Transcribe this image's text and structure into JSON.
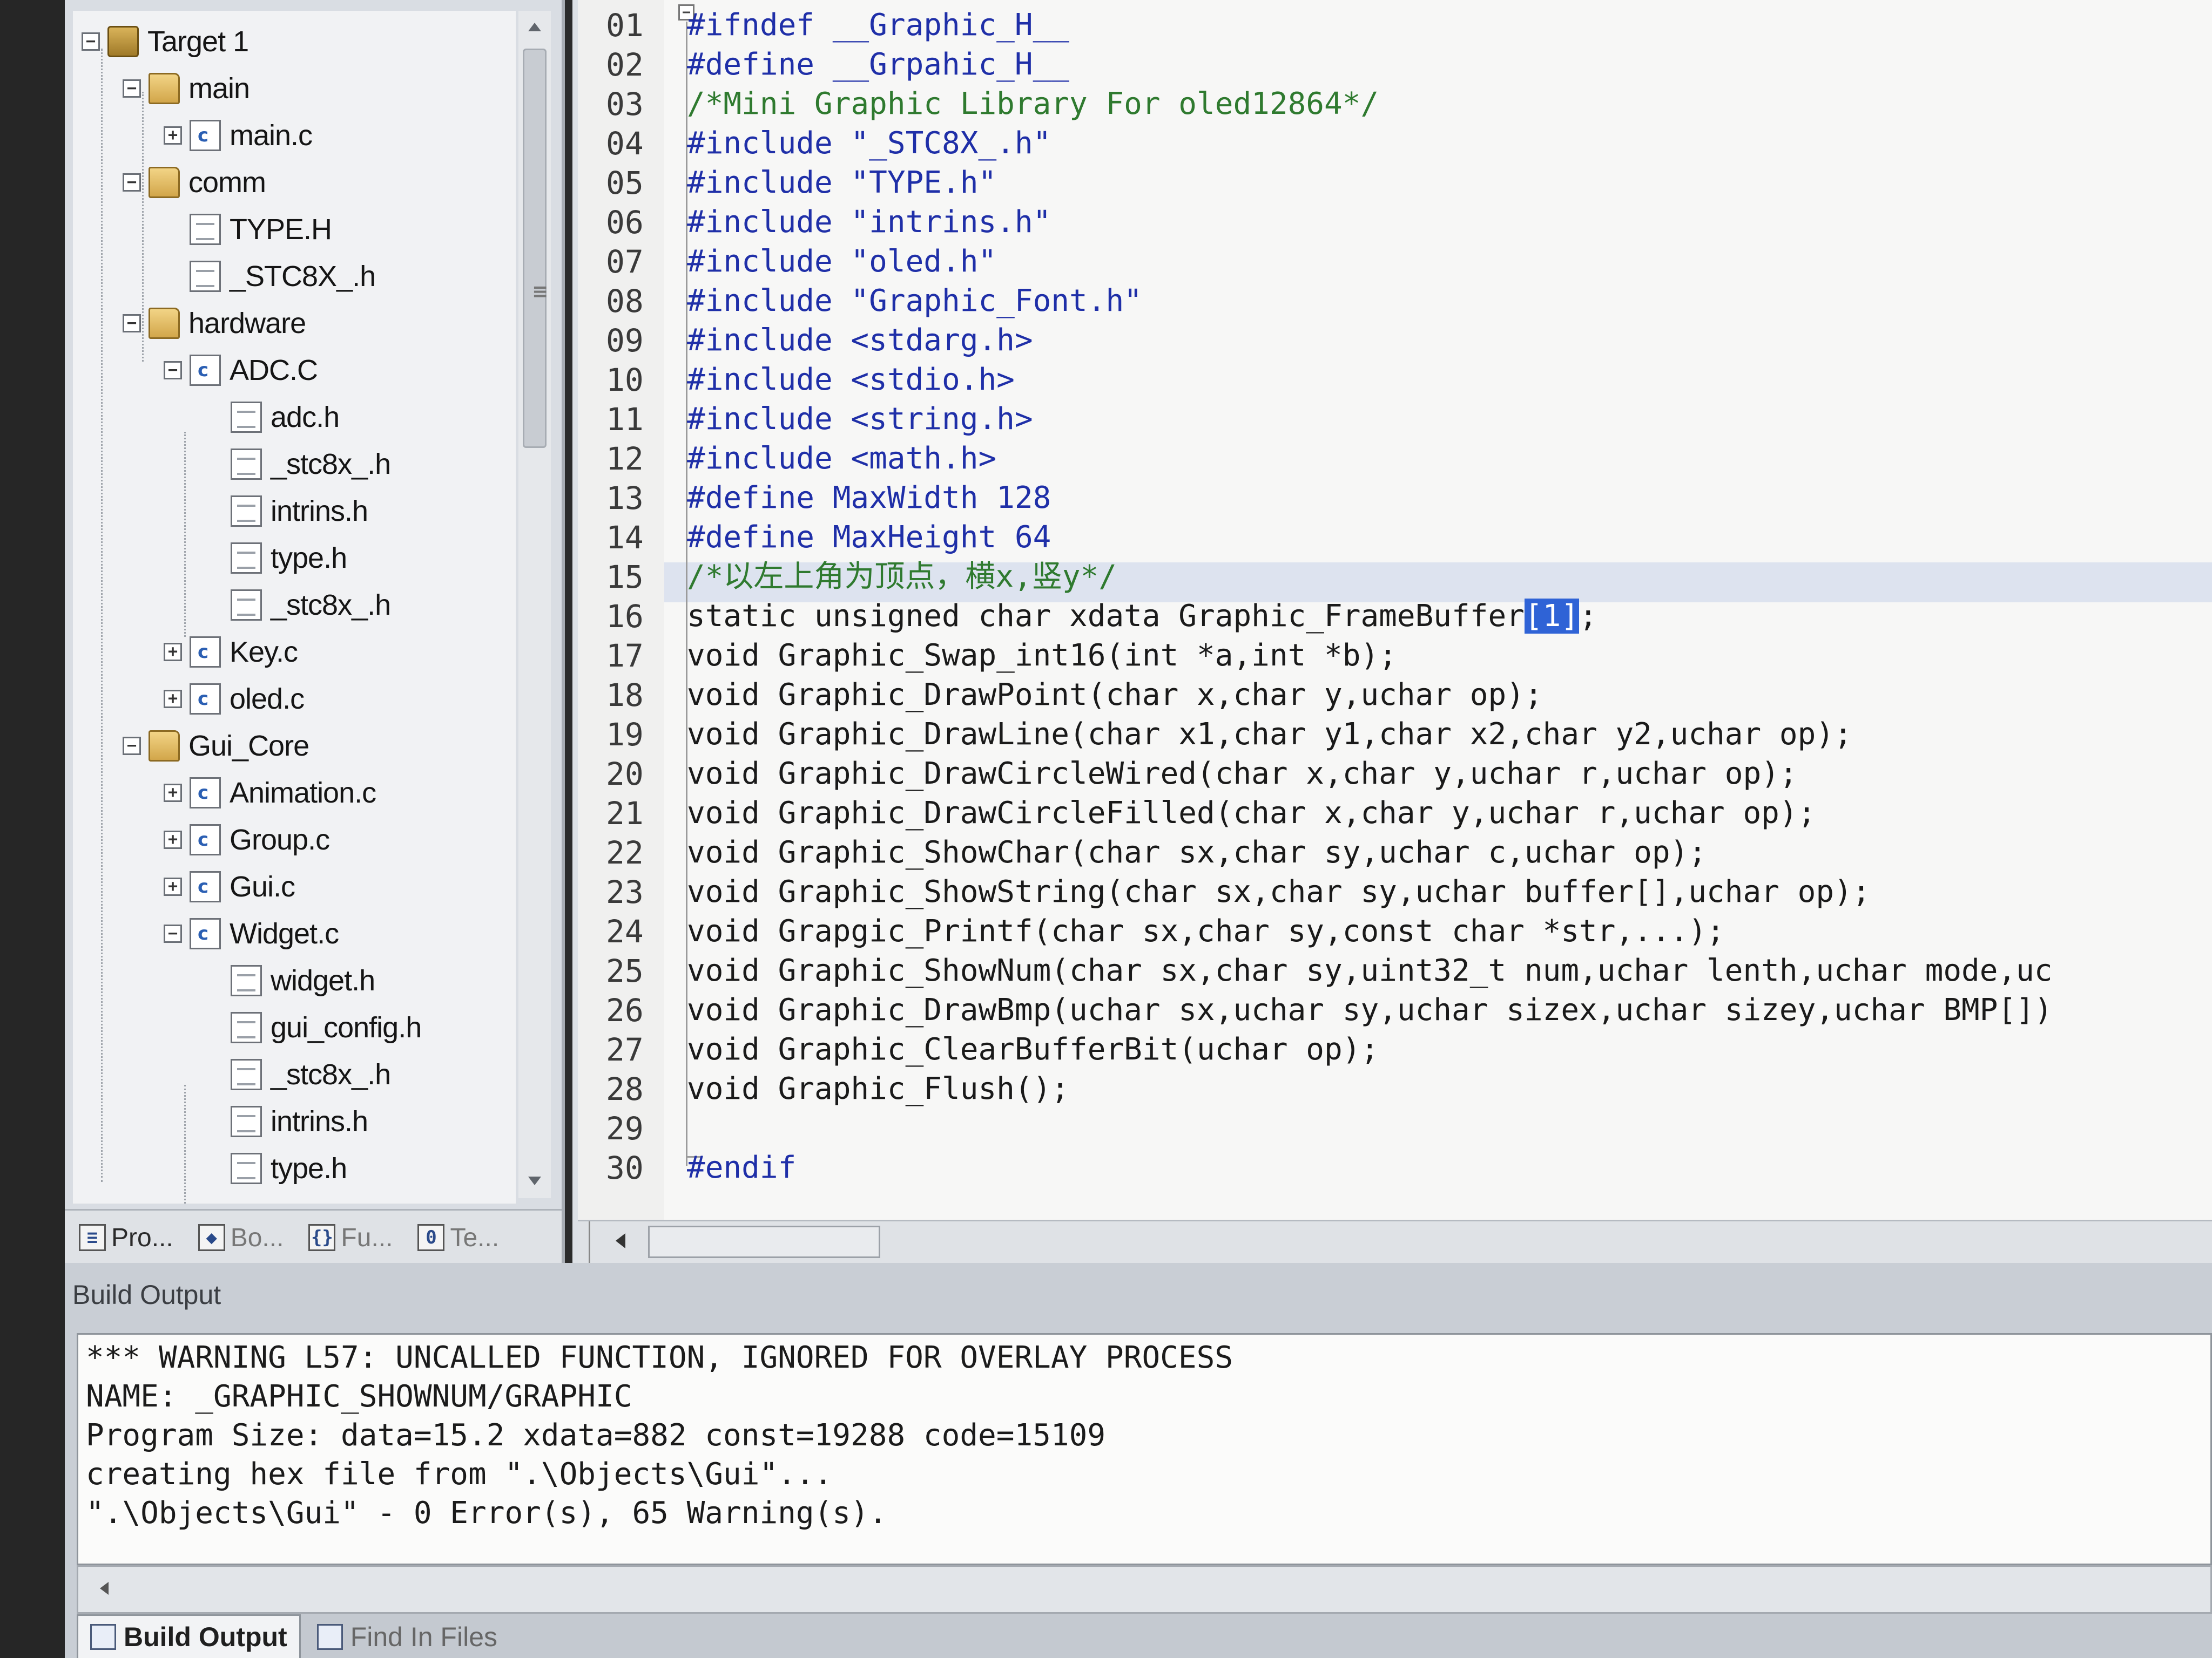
{
  "project_tree": [
    {
      "label": "Target 1",
      "type": "target",
      "level": 0,
      "expander": "-"
    },
    {
      "label": "main",
      "type": "folder",
      "level": 1,
      "expander": "-"
    },
    {
      "label": "main.c",
      "type": "cfile",
      "level": 2,
      "expander": "+"
    },
    {
      "label": "comm",
      "type": "folder",
      "level": 1,
      "expander": "-"
    },
    {
      "label": "TYPE.H",
      "type": "hfile",
      "level": 2,
      "expander": ""
    },
    {
      "label": "_STC8X_.h",
      "type": "hfile",
      "level": 2,
      "expander": ""
    },
    {
      "label": "hardware",
      "type": "folder",
      "level": 1,
      "expander": "-"
    },
    {
      "label": "ADC.C",
      "type": "cfile",
      "level": 2,
      "expander": "-"
    },
    {
      "label": "adc.h",
      "type": "hfile",
      "level": 3,
      "expander": ""
    },
    {
      "label": "_stc8x_.h",
      "type": "hfile",
      "level": 3,
      "expander": ""
    },
    {
      "label": "intrins.h",
      "type": "hfile",
      "level": 3,
      "expander": ""
    },
    {
      "label": "type.h",
      "type": "hfile",
      "level": 3,
      "expander": ""
    },
    {
      "label": "_stc8x_.h",
      "type": "hfile",
      "level": 3,
      "expander": ""
    },
    {
      "label": "Key.c",
      "type": "cfile",
      "level": 2,
      "expander": "+"
    },
    {
      "label": "oled.c",
      "type": "cfile",
      "level": 2,
      "expander": "+"
    },
    {
      "label": "Gui_Core",
      "type": "folder",
      "level": 1,
      "expander": "-"
    },
    {
      "label": "Animation.c",
      "type": "cfile",
      "level": 2,
      "expander": "+"
    },
    {
      "label": "Group.c",
      "type": "cfile",
      "level": 2,
      "expander": "+"
    },
    {
      "label": "Gui.c",
      "type": "cfile",
      "level": 2,
      "expander": "+"
    },
    {
      "label": "Widget.c",
      "type": "cfile",
      "level": 2,
      "expander": "-"
    },
    {
      "label": "widget.h",
      "type": "hfile",
      "level": 3,
      "expander": ""
    },
    {
      "label": "gui_config.h",
      "type": "hfile",
      "level": 3,
      "expander": ""
    },
    {
      "label": "_stc8x_.h",
      "type": "hfile",
      "level": 3,
      "expander": ""
    },
    {
      "label": "intrins.h",
      "type": "hfile",
      "level": 3,
      "expander": ""
    },
    {
      "label": "type.h",
      "type": "hfile",
      "level": 3,
      "expander": ""
    }
  ],
  "project_tabs": [
    {
      "label": "Pro...",
      "icon": "project-icon",
      "glyph": "≡"
    },
    {
      "label": "Bo...",
      "icon": "books-icon",
      "glyph": "◆"
    },
    {
      "label": "Fu...",
      "icon": "functions-icon",
      "glyph": "{}"
    },
    {
      "label": "Te...",
      "icon": "templates-icon",
      "glyph": "0"
    }
  ],
  "editor": {
    "lines": [
      {
        "num": "01",
        "segs": [
          {
            "t": "#ifndef  __Graphic_H__",
            "c": "pp"
          }
        ]
      },
      {
        "num": "02",
        "segs": [
          {
            "t": "#define  __Grpahic_H__",
            "c": "pp"
          }
        ]
      },
      {
        "num": "03",
        "segs": [
          {
            "t": "/*Mini Graphic Library For oled12864*/",
            "c": "cm"
          }
        ]
      },
      {
        "num": "04",
        "segs": [
          {
            "t": "#include \"_STC8X_.h\"",
            "c": "pp"
          }
        ]
      },
      {
        "num": "05",
        "segs": [
          {
            "t": "#include \"TYPE.h\"",
            "c": "pp"
          }
        ]
      },
      {
        "num": "06",
        "segs": [
          {
            "t": "#include \"intrins.h\"",
            "c": "pp"
          }
        ]
      },
      {
        "num": "07",
        "segs": [
          {
            "t": "#include \"oled.h\"",
            "c": "pp"
          }
        ]
      },
      {
        "num": "08",
        "segs": [
          {
            "t": "#include \"Graphic_Font.h\"",
            "c": "pp"
          }
        ]
      },
      {
        "num": "09",
        "segs": [
          {
            "t": "#include <stdarg.h>",
            "c": "pp"
          }
        ]
      },
      {
        "num": "10",
        "segs": [
          {
            "t": "#include <stdio.h>",
            "c": "pp"
          }
        ]
      },
      {
        "num": "11",
        "segs": [
          {
            "t": "#include <string.h>",
            "c": "pp"
          }
        ]
      },
      {
        "num": "12",
        "segs": [
          {
            "t": "#include <math.h>",
            "c": "pp"
          }
        ]
      },
      {
        "num": "13",
        "segs": [
          {
            "t": "#define MaxWidth 128",
            "c": "pp"
          }
        ]
      },
      {
        "num": "14",
        "segs": [
          {
            "t": "#define MaxHeight 64",
            "c": "pp"
          }
        ]
      },
      {
        "num": "15",
        "segs": [
          {
            "t": "/*以左上角为顶点，横x,竖y*/",
            "c": "cm"
          }
        ]
      },
      {
        "num": "16",
        "segs": [
          {
            "t": "static unsigned char xdata Graphic_FrameBuffer",
            "c": ""
          },
          {
            "t": "[1]",
            "c": "sel"
          },
          {
            "t": ";",
            "c": ""
          }
        ]
      },
      {
        "num": "17",
        "segs": [
          {
            "t": "void Graphic_Swap_int16(int *a,int *b);",
            "c": ""
          }
        ]
      },
      {
        "num": "18",
        "segs": [
          {
            "t": "void Graphic_DrawPoint(char x,char y,uchar op);",
            "c": ""
          }
        ]
      },
      {
        "num": "19",
        "segs": [
          {
            "t": "void Graphic_DrawLine(char x1,char y1,char x2,char y2,uchar op);",
            "c": ""
          }
        ]
      },
      {
        "num": "20",
        "segs": [
          {
            "t": "void Graphic_DrawCircleWired(char x,char y,uchar r,uchar op);",
            "c": ""
          }
        ]
      },
      {
        "num": "21",
        "segs": [
          {
            "t": "void Graphic_DrawCircleFilled(char x,char y,uchar r,uchar op);",
            "c": ""
          }
        ]
      },
      {
        "num": "22",
        "segs": [
          {
            "t": "void Graphic_ShowChar(char sx,char sy,uchar c,uchar op);",
            "c": ""
          }
        ]
      },
      {
        "num": "23",
        "segs": [
          {
            "t": "void Graphic_ShowString(char sx,char sy,uchar buffer[],uchar op);",
            "c": ""
          }
        ]
      },
      {
        "num": "24",
        "segs": [
          {
            "t": "void Grapgic_Printf(char sx,char sy,const char *str,...);",
            "c": ""
          }
        ]
      },
      {
        "num": "25",
        "segs": [
          {
            "t": "void Graphic_ShowNum(char sx,char sy,uint32_t num,uchar lenth,uchar mode,uc",
            "c": ""
          }
        ]
      },
      {
        "num": "26",
        "segs": [
          {
            "t": "void Graphic_DrawBmp(uchar sx,uchar sy,uchar sizex,uchar sizey,uchar BMP[])",
            "c": ""
          }
        ]
      },
      {
        "num": "27",
        "segs": [
          {
            "t": "void Graphic_ClearBufferBit(uchar op);",
            "c": ""
          }
        ]
      },
      {
        "num": "28",
        "segs": [
          {
            "t": "void Graphic_Flush();",
            "c": ""
          }
        ]
      },
      {
        "num": "29",
        "segs": [
          {
            "t": "",
            "c": ""
          }
        ]
      },
      {
        "num": "30",
        "segs": [
          {
            "t": "#endif",
            "c": "pp"
          }
        ]
      }
    ]
  },
  "build": {
    "title": "Build Output",
    "lines": [
      "*** WARNING L57: UNCALLED FUNCTION, IGNORED FOR OVERLAY PROCESS",
      "    NAME:     _GRAPHIC_SHOWNUM/GRAPHIC",
      "Program Size: data=15.2 xdata=882 const=19288 code=15109",
      "creating hex file from \".\\Objects\\Gui\"...",
      "\".\\Objects\\Gui\" - 0 Error(s), 65 Warning(s)."
    ],
    "tabs": [
      {
        "label": "Build Output",
        "active": true
      },
      {
        "label": "Find In Files",
        "active": false
      }
    ]
  },
  "colors": {
    "preprocessor": "#1f2fa8",
    "comment": "#2f7a2f",
    "selection": "#2f63d6",
    "current_line": "#dde3ef"
  }
}
